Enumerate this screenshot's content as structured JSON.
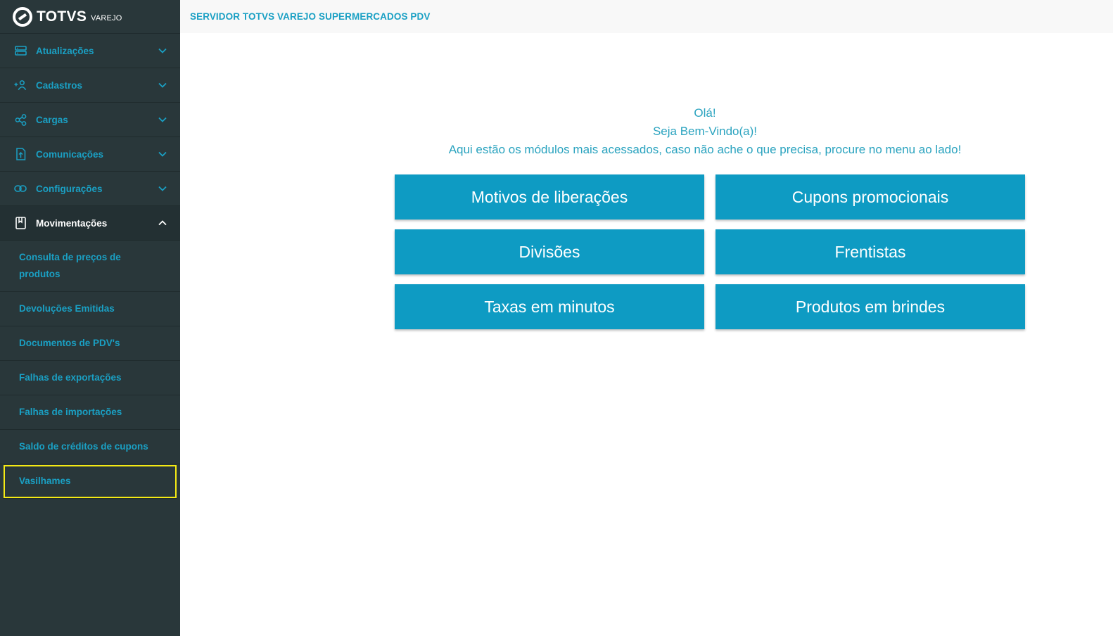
{
  "app": {
    "logo_text": "TOTVS",
    "logo_sub": "VAREJO"
  },
  "header": {
    "title": "SERVIDOR TOTVS VAREJO SUPERMERCADOS PDV"
  },
  "sidebar": {
    "menus": [
      {
        "label": "Atualizações",
        "icon": "server-icon"
      },
      {
        "label": "Cadastros",
        "icon": "add-user-icon"
      },
      {
        "label": "Cargas",
        "icon": "share-icon"
      },
      {
        "label": "Comunicações",
        "icon": "file-upload-icon"
      },
      {
        "label": "Configurações",
        "icon": "link-icon"
      },
      {
        "label": "Movimentações",
        "icon": "bookmark-icon"
      }
    ],
    "submenu": [
      {
        "label": "Consulta de preços de produtos"
      },
      {
        "label": "Devoluções Emitidas"
      },
      {
        "label": "Documentos de PDV's"
      },
      {
        "label": "Falhas de exportações"
      },
      {
        "label": "Falhas de importações"
      },
      {
        "label": "Saldo de créditos de cupons"
      },
      {
        "label": "Vasilhames"
      }
    ]
  },
  "welcome": {
    "line1": "Olá!",
    "line2": "Seja Bem-Vindo(a)!",
    "line3": "Aqui estão os módulos mais acessados, caso não ache o que precisa, procure no menu ao lado!"
  },
  "tiles": [
    {
      "label": "Motivos de liberações"
    },
    {
      "label": "Cupons promocionais"
    },
    {
      "label": "Divisões"
    },
    {
      "label": "Frentistas"
    },
    {
      "label": "Taxas em minutos"
    },
    {
      "label": "Produtos em brindes"
    }
  ],
  "colors": {
    "accent": "#1aa0c4",
    "sidebar_bg": "#29373a",
    "tile_bg": "#0e9bc3",
    "highlight": "#f5ea14"
  }
}
